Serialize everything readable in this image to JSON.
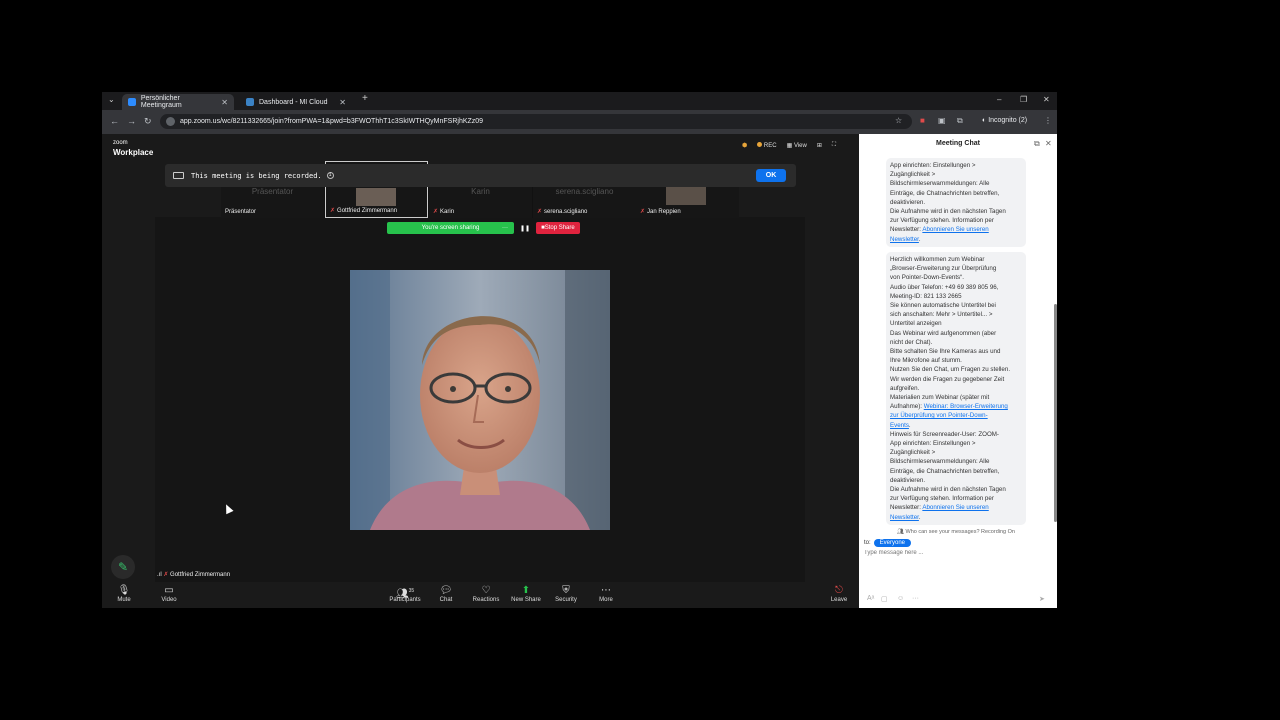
{
  "browser": {
    "tabs": [
      {
        "label": "Persönlicher Meetingraum"
      },
      {
        "label": "Dashboard - MI Cloud"
      }
    ],
    "new_tab": "+",
    "url": "app.zoom.us/wc/8211332665/join?fromPWA=1&pwd=b3FWOThhT1c3SkIWTHQyMnFSRjhKZz09",
    "incognito_label": "Incognito (2)"
  },
  "zoom": {
    "logo_small": "zoom",
    "logo_big": "Workplace",
    "top_rec": "REC",
    "top_view": "View",
    "recording_banner": "This meeting is being recorded.",
    "ok_label": "OK",
    "thumbnails": [
      {
        "name": "Präsentator",
        "ghost": "Präsentator",
        "muted": false
      },
      {
        "name": "Gottfried Zimmermann",
        "ghost": "",
        "muted": true
      },
      {
        "name": "Karin",
        "ghost": "Karin",
        "muted": true
      },
      {
        "name": "serena.scigliano",
        "ghost": "serena.scigliano",
        "muted": true
      },
      {
        "name": "Jan Reppien",
        "ghost": "",
        "muted": true
      }
    ],
    "sharing_label": "You're screen sharing",
    "stop_share_label": "Stop Share",
    "speaker_name": "Gottfried Zimmermann",
    "participant_count": "35",
    "controls": {
      "mute": "Mute",
      "video": "Video",
      "participants": "Participants",
      "chat": "Chat",
      "reactions": "Reactions",
      "new_share": "New Share",
      "security": "Security",
      "more": "More",
      "leave": "Leave"
    }
  },
  "chat": {
    "title": "Meeting Chat",
    "msg1_lines": [
      "App einrichten: Einstellungen >",
      "Zugänglichkeit >",
      "Bildschirmleserwarnmeldungen: Alle",
      "Einträge, die Chatnachrichten betreffen,",
      "deaktivieren.",
      "Die Aufnahme wird in den nächsten Tagen",
      "zur Verfügung stehen. Information per",
      "Newsletter:"
    ],
    "msg1_link1": "Abonnieren Sie unseren",
    "msg1_link2": "Newsletter",
    "msg2_lines": [
      "Herzlich willkommen zum Webinar",
      "„Browser-Erweiterung zur Überprüfung",
      "von Pointer-Down-Events“.",
      "Audio über Telefon: +49 69 389 805 96,",
      "Meeting-ID: 821 133 2665",
      "Sie können automatische Untertitel bei",
      "sich anschalten: Mehr > Untertitel... >",
      "Untertitel anzeigen",
      "Das Webinar wird aufgenommen (aber",
      "nicht der Chat).",
      "Bitte schalten Sie Ihre Kameras aus und",
      "Ihre Mikrofone auf stumm.",
      "Nutzen Sie den Chat, um Fragen zu stellen.",
      "Wir werden die Fragen zu gegebener Zeit",
      "aufgreifen.",
      "Materialien zum Webinar (später mit",
      "Aufnahme):"
    ],
    "msg2_link_a": "Webinar: Browser-Erweiterung",
    "msg2_link_b": "zur Überprüfung von Pointer-Down-",
    "msg2_link_c": "Events",
    "msg2_lines_b": [
      "Hinweis für Screenreader-User: ZOOM-",
      "App einrichten: Einstellungen >",
      "Zugänglichkeit >",
      "Bildschirmleserwarnmeldungen: Alle",
      "Einträge, die Chatnachrichten betreffen,",
      "deaktivieren.",
      "Die Aufnahme wird in den nächsten Tagen",
      "zur Verfügung stehen. Information per",
      "Newsletter:"
    ],
    "msg2_link1": "Abonnieren Sie unseren",
    "msg2_link2": "Newsletter",
    "privacy": "Who can see your messages? Recording On",
    "to_label": "to:",
    "recipient": "Everyone",
    "input_placeholder": "Type message here ..."
  },
  "colors": {
    "accent": "#0e72ed",
    "sharing_green": "#27c24c",
    "stop_red": "#e0233e"
  }
}
